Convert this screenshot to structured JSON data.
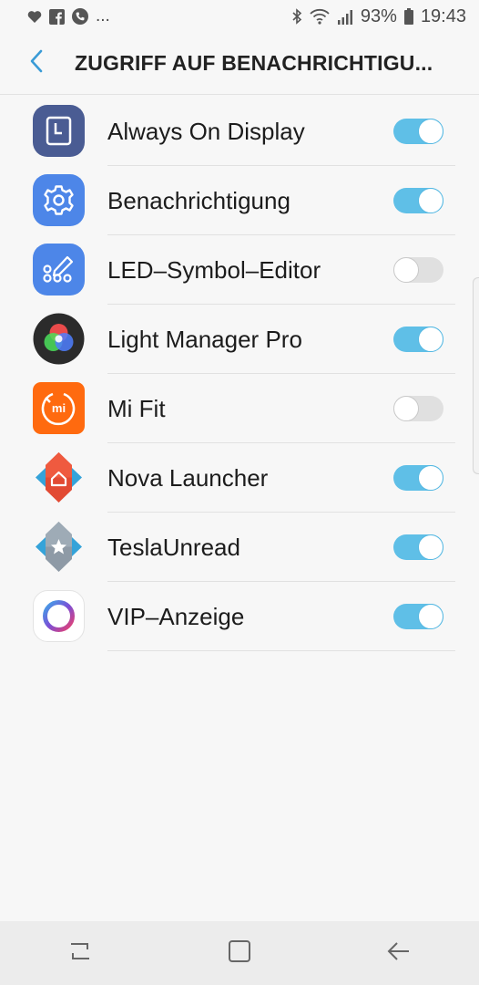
{
  "status_bar": {
    "left_icons": [
      "heart-icon",
      "facebook-icon",
      "phone-icon"
    ],
    "more_indicator": "...",
    "right_icons": [
      "bluetooth-icon",
      "wifi-icon",
      "signal-icon"
    ],
    "battery": "93%",
    "time": "19:43"
  },
  "header": {
    "back_icon": "chevron-left-icon",
    "title": "ZUGRIFF AUF BENACHRICHTIGU..."
  },
  "apps": [
    {
      "label": "Always On Display",
      "enabled": true,
      "icon": "always-on-display-icon"
    },
    {
      "label": "Benachrichtigung",
      "enabled": true,
      "icon": "settings-gear-icon"
    },
    {
      "label": "LED–Symbol–Editor",
      "enabled": false,
      "icon": "led-editor-icon"
    },
    {
      "label": "Light Manager Pro",
      "enabled": true,
      "icon": "rgb-light-icon"
    },
    {
      "label": "Mi Fit",
      "enabled": false,
      "icon": "mi-fit-icon"
    },
    {
      "label": "Nova Launcher",
      "enabled": true,
      "icon": "nova-launcher-icon"
    },
    {
      "label": "TeslaUnread",
      "enabled": true,
      "icon": "tesla-unread-icon"
    },
    {
      "label": "VIP–Anzeige",
      "enabled": true,
      "icon": "vip-ring-icon"
    }
  ],
  "nav_bar": {
    "buttons": [
      "recents-icon",
      "home-icon",
      "back-icon"
    ]
  },
  "colors": {
    "toggle_on": "#5fbfe7",
    "toggle_off": "#e0e0e0",
    "accent": "#3a9bd6"
  }
}
